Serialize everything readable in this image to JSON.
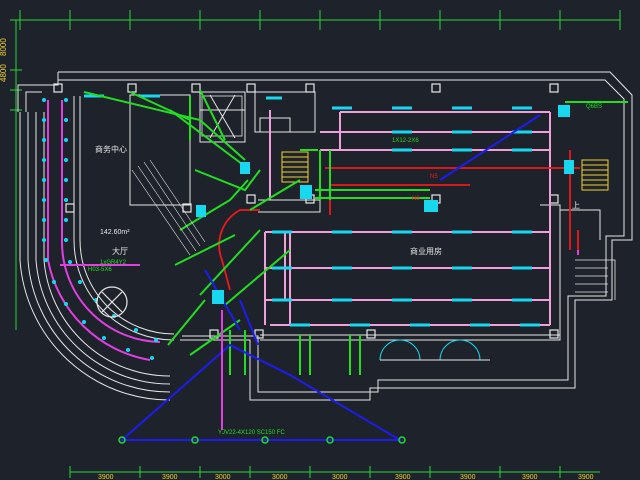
{
  "colors": {
    "background": "#1e232b",
    "wall": "#e6e6e6",
    "dim": "#29d43a",
    "pink": "#f0a0d8",
    "cyan": "#18d8f0",
    "green": "#22dd22",
    "red": "#f01818",
    "blue": "#1c1cf0",
    "magenta": "#e040e0",
    "yellow": "#f0d030",
    "label": "#e6e6e6"
  },
  "left_dims": [
    "8000",
    "4800"
  ],
  "bottom_dims": [
    "3900",
    "3900",
    "3000",
    "3000",
    "3000",
    "3900",
    "3900",
    "3900",
    "3900"
  ],
  "rooms": {
    "business_center": "商务中心",
    "hall_area": "142.60m²",
    "hall": "大厅",
    "commercial_hall": "商业用房",
    "upper": "上"
  },
  "annotations": {
    "hall_feeder": "1xGR4Y2",
    "hall_feeder_code": "H03-5X6",
    "right_feeder": "1X12-2X6",
    "top_right_code": "Q6BS",
    "main_feeder": "YJV22-4X120 SC150 FC",
    "h_tag_1": "N5",
    "h_tag_2": "N6"
  }
}
